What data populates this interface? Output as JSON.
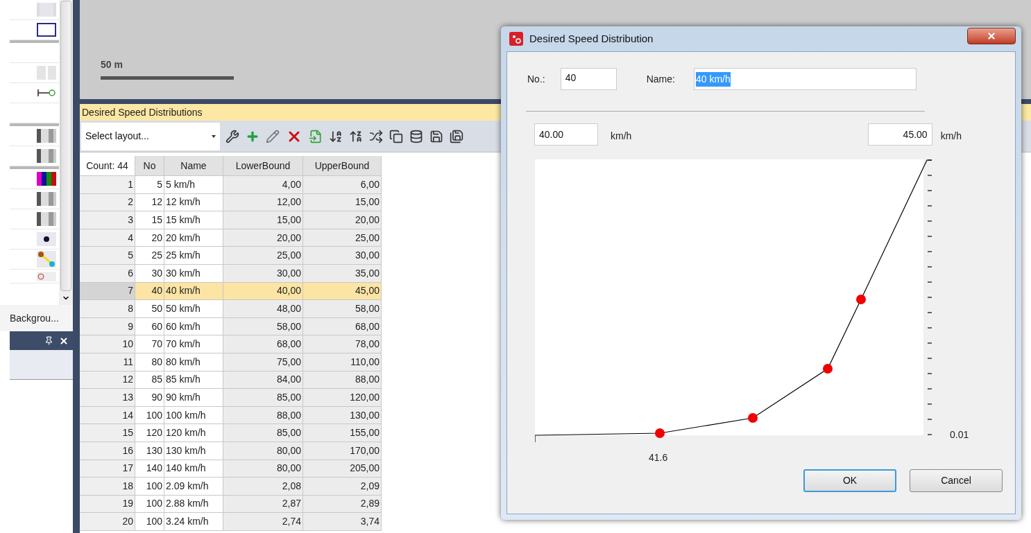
{
  "left_panel": {
    "tab_label": "Backgrou..."
  },
  "canvas": {
    "scale_label": "50 m"
  },
  "list_window": {
    "title": "Desired Speed Distributions",
    "layout_select": {
      "value": "Select layout..."
    },
    "table": {
      "columns": [
        "Count: 44",
        "No",
        "Name",
        "LowerBound",
        "UpperBound"
      ],
      "rows": [
        {
          "cells": [
            "1",
            "5",
            "5 km/h",
            "4,00",
            "6,00"
          ],
          "selected": false
        },
        {
          "cells": [
            "2",
            "12",
            "12 km/h",
            "12,00",
            "15,00"
          ],
          "selected": false
        },
        {
          "cells": [
            "3",
            "15",
            "15 km/h",
            "15,00",
            "20,00"
          ],
          "selected": false
        },
        {
          "cells": [
            "4",
            "20",
            "20 km/h",
            "20,00",
            "25,00"
          ],
          "selected": false
        },
        {
          "cells": [
            "5",
            "25",
            "25 km/h",
            "25,00",
            "30,00"
          ],
          "selected": false
        },
        {
          "cells": [
            "6",
            "30",
            "30 km/h",
            "30,00",
            "35,00"
          ],
          "selected": false
        },
        {
          "cells": [
            "7",
            "40",
            "40 km/h",
            "40,00",
            "45,00"
          ],
          "selected": true
        },
        {
          "cells": [
            "8",
            "50",
            "50 km/h",
            "48,00",
            "58,00"
          ],
          "selected": false
        },
        {
          "cells": [
            "9",
            "60",
            "60 km/h",
            "58,00",
            "68,00"
          ],
          "selected": false
        },
        {
          "cells": [
            "10",
            "70",
            "70 km/h",
            "68,00",
            "78,00"
          ],
          "selected": false
        },
        {
          "cells": [
            "11",
            "80",
            "80 km/h",
            "75,00",
            "110,00"
          ],
          "selected": false
        },
        {
          "cells": [
            "12",
            "85",
            "85 km/h",
            "84,00",
            "88,00"
          ],
          "selected": false
        },
        {
          "cells": [
            "13",
            "90",
            "90 km/h",
            "85,00",
            "120,00"
          ],
          "selected": false
        },
        {
          "cells": [
            "14",
            "100",
            "100 km/h",
            "88,00",
            "130,00"
          ],
          "selected": false
        },
        {
          "cells": [
            "15",
            "120",
            "120 km/h",
            "85,00",
            "155,00"
          ],
          "selected": false
        },
        {
          "cells": [
            "16",
            "130",
            "130 km/h",
            "80,00",
            "170,00"
          ],
          "selected": false
        },
        {
          "cells": [
            "17",
            "140",
            "140 km/h",
            "80,00",
            "205,00"
          ],
          "selected": false
        },
        {
          "cells": [
            "18",
            "100",
            "2.09 km/h",
            "2,08",
            "2,09"
          ],
          "selected": false
        },
        {
          "cells": [
            "19",
            "100",
            "2.88 km/h",
            "2,87",
            "2,89"
          ],
          "selected": false
        },
        {
          "cells": [
            "20",
            "100",
            "3.24 km/h",
            "2,74",
            "3,74"
          ],
          "selected": false
        }
      ]
    }
  },
  "dialog": {
    "title": "Desired Speed Distribution",
    "no_label": "No.:",
    "no_value": "40",
    "name_label": "Name:",
    "name_field": {
      "value": "40 km/h",
      "text_selected": true
    },
    "lower_value": "40.00",
    "lower_unit": "km/h",
    "upper_value": "45.00",
    "upper_unit": "km/h",
    "x_axis_label": "41.6",
    "y_axis_label": "0.01",
    "buttons": [
      {
        "label": "OK",
        "focused": true
      },
      {
        "label": "Cancel",
        "focused": false
      }
    ]
  }
}
